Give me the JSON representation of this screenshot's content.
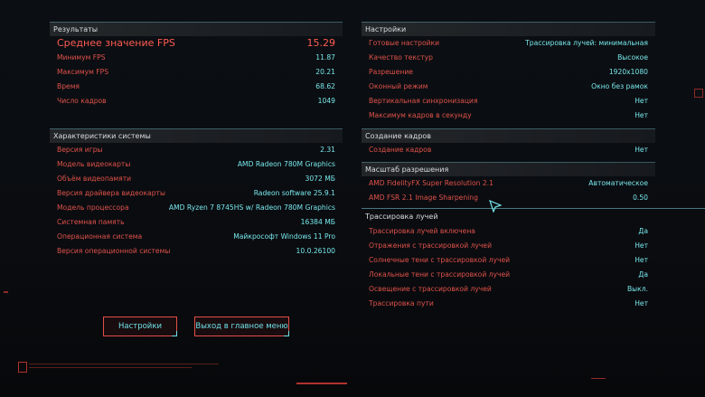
{
  "left": {
    "results": {
      "title": "Результаты",
      "rows": [
        {
          "label": "Среднее значение FPS",
          "value": "15.29"
        },
        {
          "label": "Минимум FPS",
          "value": "11.87"
        },
        {
          "label": "Максимум FPS",
          "value": "20.21"
        },
        {
          "label": "Время",
          "value": "68.62"
        },
        {
          "label": "Число кадров",
          "value": "1049"
        }
      ]
    },
    "system": {
      "title": "Характеристики системы",
      "rows": [
        {
          "label": "Версия игры",
          "value": "2.31"
        },
        {
          "label": "Модель видеокарты",
          "value": "AMD Radeon 780M Graphics"
        },
        {
          "label": "Объём видеопамяти",
          "value": "3072 МБ"
        },
        {
          "label": "Версия драйвера видеокарты",
          "value": "Radeon software 25.9.1"
        },
        {
          "label": "Модель процессора",
          "value": "AMD Ryzen 7 8745HS w/ Radeon 780M Graphics"
        },
        {
          "label": "Системная память",
          "value": "16384 МБ"
        },
        {
          "label": "Операционная система",
          "value": "Майкрософт Windows 11 Pro"
        },
        {
          "label": "Версия операционной системы",
          "value": "10.0.26100"
        }
      ]
    }
  },
  "right": {
    "settings": {
      "title": "Настройки",
      "rows": [
        {
          "label": "Готовые настройки",
          "value": "Трассировка лучей: минимальная"
        },
        {
          "label": "Качество текстур",
          "value": "Высокое"
        },
        {
          "label": "Разрешение",
          "value": "1920x1080"
        },
        {
          "label": "Оконный режим",
          "value": "Окно без рамок"
        },
        {
          "label": "Вертикальная синхронизация",
          "value": "Нет"
        },
        {
          "label": "Максимум кадров в секунду",
          "value": "Нет"
        }
      ]
    },
    "framegen": {
      "title": "Создание кадров",
      "rows": [
        {
          "label": "Создание кадров",
          "value": "Нет"
        }
      ]
    },
    "scaling": {
      "title": "Масштаб разрешения",
      "rows": [
        {
          "label": "AMD FidelityFX Super Resolution 2.1",
          "value": "Автоматическое"
        },
        {
          "label": "AMD FSR 2.1 Image Sharpening",
          "value": "0.50"
        }
      ]
    },
    "raytracing": {
      "title": "Трассировка лучей",
      "rows": [
        {
          "label": "Трассировка лучей включена",
          "value": "Да"
        },
        {
          "label": "Отражения с трассировкой лучей",
          "value": "Нет"
        },
        {
          "label": "Солнечные тени с трассировкой лучей",
          "value": "Нет"
        },
        {
          "label": "Локальные тени с трассировкой лучей",
          "value": "Да"
        },
        {
          "label": "Освещение с трассировкой лучей",
          "value": "Выкл."
        },
        {
          "label": "Трассировка пути",
          "value": "Нет"
        }
      ]
    }
  },
  "buttons": {
    "settings": "Настройки",
    "main_menu": "Выход в главное меню"
  },
  "colors": {
    "label": "#e0524a",
    "value": "#77e6ea",
    "accent": "#ff5b52"
  }
}
